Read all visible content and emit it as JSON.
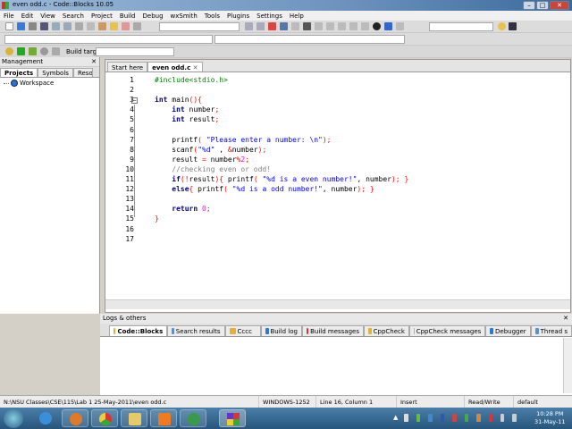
{
  "window": {
    "title": "even odd.c - Code::Blocks 10.05",
    "min": "–",
    "max": "□",
    "close": "✕"
  },
  "menu": [
    "File",
    "Edit",
    "View",
    "Search",
    "Project",
    "Build",
    "Debug",
    "wxSmith",
    "Tools",
    "Plugins",
    "Settings",
    "Help"
  ],
  "toolbar": {
    "build_target_label": "Build target:",
    "build_target_value": ""
  },
  "management": {
    "title": "Management",
    "close": "✕",
    "tabs": [
      "Projects",
      "Symbols",
      "Resources"
    ],
    "tree": [
      "Workspace"
    ]
  },
  "editor": {
    "tabs": [
      "Start here",
      "even odd.c"
    ],
    "tab_close": "✕",
    "lines": [
      [
        [
          "pp",
          "#include<stdio.h>"
        ]
      ],
      [],
      [
        [
          "k",
          "int"
        ],
        [
          "i",
          " main"
        ],
        [
          "p",
          "(){"
        ]
      ],
      [
        [
          "i",
          "    "
        ],
        [
          "k",
          "int"
        ],
        [
          "i",
          " number"
        ],
        [
          "p",
          ";"
        ]
      ],
      [
        [
          "i",
          "    "
        ],
        [
          "k",
          "int"
        ],
        [
          "i",
          " result"
        ],
        [
          "p",
          ";"
        ]
      ],
      [],
      [
        [
          "i",
          "    printf"
        ],
        [
          "p",
          "("
        ],
        [
          "s",
          " \"Please enter a number: \\n\""
        ],
        [
          "p",
          ");"
        ]
      ],
      [
        [
          "i",
          "    scanf"
        ],
        [
          "p",
          "("
        ],
        [
          "s",
          "\"%d\""
        ],
        [
          "i",
          " , "
        ],
        [
          "p",
          "&"
        ],
        [
          "i",
          "number"
        ],
        [
          "p",
          ");"
        ]
      ],
      [
        [
          "i",
          "    result "
        ],
        [
          "p",
          "="
        ],
        [
          "i",
          " number"
        ],
        [
          "p",
          "%"
        ],
        [
          "n",
          "2"
        ],
        [
          "p",
          ";"
        ]
      ],
      [
        [
          "c",
          "    //checking even or odd!"
        ]
      ],
      [
        [
          "i",
          "    "
        ],
        [
          "k",
          "if"
        ],
        [
          "p",
          "(!"
        ],
        [
          "i",
          "result"
        ],
        [
          "p",
          ")"
        ],
        [
          "p",
          "{"
        ],
        [
          "i",
          " printf"
        ],
        [
          "p",
          "("
        ],
        [
          "s",
          " \"%d is a even number!\""
        ],
        [
          "i",
          ", number"
        ],
        [
          "p",
          ");"
        ],
        [
          "i",
          " "
        ],
        [
          "p",
          "}"
        ]
      ],
      [
        [
          "i",
          "    "
        ],
        [
          "k",
          "else"
        ],
        [
          "p",
          "{"
        ],
        [
          "i",
          " printf"
        ],
        [
          "p",
          "("
        ],
        [
          "s",
          " \"%d is a odd number!\""
        ],
        [
          "i",
          ", number"
        ],
        [
          "p",
          ");"
        ],
        [
          "i",
          " "
        ],
        [
          "p",
          "}"
        ]
      ],
      [],
      [
        [
          "i",
          "    "
        ],
        [
          "k",
          "return"
        ],
        [
          "i",
          " "
        ],
        [
          "n",
          "0"
        ],
        [
          "p",
          ";"
        ]
      ],
      [
        [
          "p",
          "}"
        ]
      ],
      [],
      []
    ]
  },
  "logs": {
    "title": "Logs & others",
    "close": "✕",
    "tabs": [
      "Code::Blocks",
      "Search results",
      "Cccc",
      "Build log",
      "Build messages",
      "CppCheck",
      "CppCheck messages",
      "Debugger",
      "Thread s"
    ]
  },
  "status": {
    "path": "N:\\NSU Classes\\CSE\\115\\Lab 1 25-May-2011\\even odd.c",
    "encoding": "WINDOWS-1252",
    "position": "Line 16, Column 1",
    "mode": "Insert",
    "access": "Read/Write",
    "lang": "default"
  },
  "taskbar": {
    "time": "10:28 PM",
    "date": "31-May-11"
  }
}
